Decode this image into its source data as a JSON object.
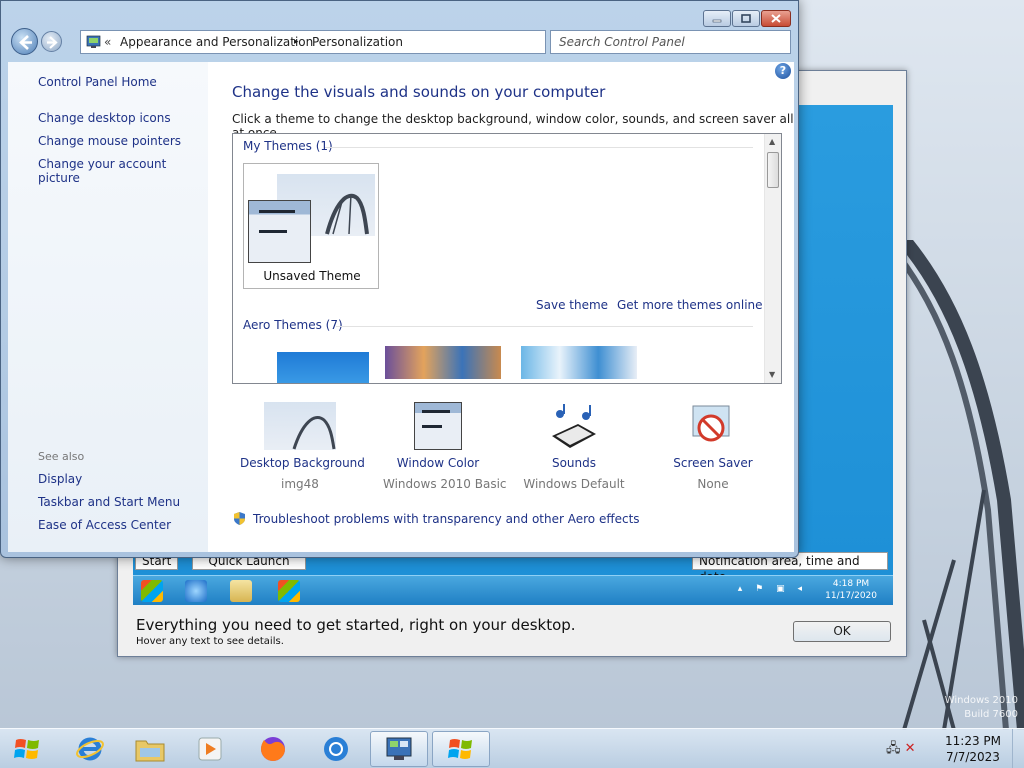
{
  "window": {
    "breadcrumb_prefix": "«",
    "breadcrumb": [
      "Appearance and Personalization",
      "Personalization"
    ],
    "breadcrumb_sep": "▸",
    "search_placeholder": "Search Control Panel",
    "help_glyph": "?"
  },
  "left_pane": {
    "home": "Control Panel Home",
    "links": [
      "Change desktop icons",
      "Change mouse pointers",
      "Change your account picture"
    ],
    "see_also_label": "See also",
    "see_also": [
      "Display",
      "Taskbar and Start Menu",
      "Ease of Access Center"
    ]
  },
  "main": {
    "title": "Change the visuals and sounds on your computer",
    "description": "Click a theme to change the desktop background, window color, sounds, and screen saver all at once.",
    "my_themes_label": "My Themes (1)",
    "unsaved_theme": "Unsaved Theme",
    "save_theme": "Save theme",
    "get_more_themes": "Get more themes online",
    "aero_themes_label": "Aero Themes (7)"
  },
  "bottom_items": [
    {
      "label": "Desktop Background",
      "value": "img48",
      "icon": "desktop-background-icon"
    },
    {
      "label": "Window Color",
      "value": "Windows 2010 Basic",
      "icon": "window-color-icon"
    },
    {
      "label": "Sounds",
      "value": "Windows Default",
      "icon": "sounds-icon"
    },
    {
      "label": "Screen Saver",
      "value": "None",
      "icon": "screen-saver-icon"
    }
  ],
  "troubleshoot_link": "Troubleshoot problems with transparency and other Aero effects",
  "tour_dialog": {
    "label_start": "Start",
    "label_quick_launch": "Quick Launch",
    "label_notification": "Notification area, time and date",
    "inner_clock_time": "4:18 PM",
    "inner_clock_date": "11/17/2020",
    "message": "Everything you need to get started, right on your desktop.",
    "hint": "Hover any text to see details.",
    "ok_label": "OK"
  },
  "taskbar": {
    "clock_time": "11:23 PM",
    "clock_date": "7/7/2023",
    "pinned": [
      "start-orb-icon",
      "internet-explorer-icon",
      "file-explorer-icon",
      "media-player-icon",
      "firefox-icon",
      "chrome-icon",
      "control-panel-icon",
      "windows-logo-icon"
    ]
  },
  "desktop_watermark": [
    "Windows 2010",
    "Build 7600"
  ],
  "colors": {
    "link": "#1e3287",
    "title": "#1e3287",
    "muted": "#777777",
    "accent_blue": "#2b9fdc"
  }
}
